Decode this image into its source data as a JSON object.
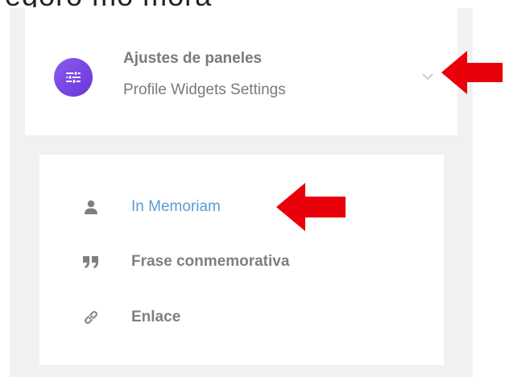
{
  "top_text": "egoro mo mora",
  "accordion": {
    "title": "Ajustes de paneles",
    "subtitle": "Profile Widgets Settings",
    "icon": "sliders-icon",
    "expanded": true
  },
  "menu": {
    "items": [
      {
        "label": "In Memoriam",
        "icon": "user-icon",
        "active": true
      },
      {
        "label": "Frase conmemorativa",
        "icon": "quote-icon",
        "active": false
      },
      {
        "label": "Enlace",
        "icon": "link-icon",
        "active": false
      }
    ]
  },
  "colors": {
    "accent_purple": "#7b47e6",
    "active_link": "#5b9bd5",
    "text_gray": "#7a7a7a",
    "panel_bg": "#f1f1f2",
    "annotation_red": "#e8000a"
  }
}
